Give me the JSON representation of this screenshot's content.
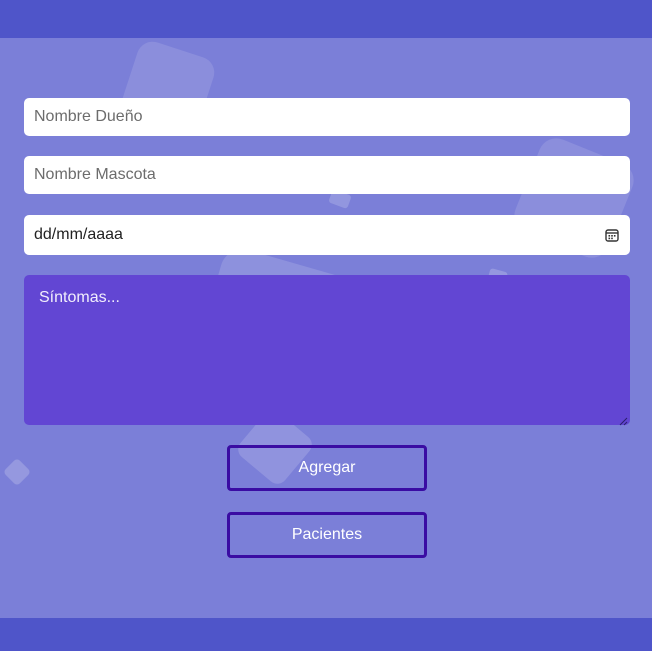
{
  "form": {
    "owner_placeholder": "Nombre Dueño",
    "pet_placeholder": "Nombre Mascota",
    "date_placeholder": "dd/mm/aaaa",
    "date_icon": "calendar-icon",
    "symptoms_placeholder": "Síntomas..."
  },
  "buttons": {
    "add_label": "Agregar",
    "patients_label": "Pacientes"
  },
  "colors": {
    "background": "#7b7fd8",
    "bar": "#4f55c9",
    "textarea": "#6246d3",
    "button_border": "#3a0ca3"
  }
}
